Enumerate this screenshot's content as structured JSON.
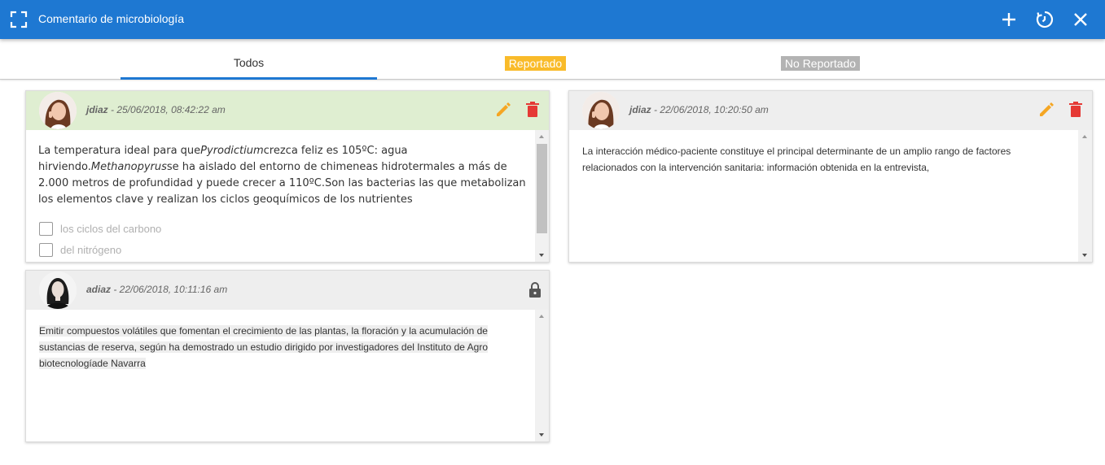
{
  "topbar": {
    "title": "Comentario de microbiología",
    "icons": {
      "expand": "fullscreen-icon",
      "add": "plus-icon",
      "history": "clock-rotate-icon",
      "close": "close-icon"
    }
  },
  "tabs": {
    "all": "Todos",
    "reported": "Reportado",
    "not_reported": "No Reportado",
    "colors": {
      "accent": "#1e78d2",
      "reported": "#f9bb2a",
      "not_reported": "#b3b3b3"
    }
  },
  "comments": [
    {
      "user": "jdiaz",
      "date": " - 25/06/2018, 08:42:22 am",
      "text_parts": [
        "La temperatura ideal para que",
        "Pyrodictium",
        "crezca feliz es 105ºC: agua hirviendo.",
        "Methanopyrus",
        "se ha aislado del entorno de chimeneas hidrotermales a más de 2.000 metros de profundidad y puede crecer a 110ºC.Son las bacterias las que metabolizan los elementos clave y realizan los ciclos geoquímicos de los nutrientes"
      ],
      "checkboxes": [
        "los ciclos del carbono",
        "del nitrógeno"
      ],
      "header_color": "#dfeed1",
      "actions": [
        "edit-icon",
        "delete-icon"
      ]
    },
    {
      "user": "jdiaz",
      "date": " - 22/06/2018, 10:20:50 am",
      "text": "La interacción médico-paciente constituye el principal determinante de un amplio rango de factores relacionados con la intervención sanitaria: información obtenida en la entrevista,",
      "header_color": "#eeeeee",
      "actions": [
        "edit-icon",
        "delete-icon"
      ]
    },
    {
      "user": "adiaz",
      "date": " - 22/06/2018, 10:11:16 am",
      "text": "Emitir compuestos volátiles que fomentan el crecimiento de las plantas, la floración y la acumulación de sustancias de reserva, según ha demostrado un estudio dirigido por investigadores del Instituto de Agro biotecnologíade Navarra",
      "header_color": "#eeeeee",
      "actions": [
        "lock-icon"
      ]
    }
  ]
}
